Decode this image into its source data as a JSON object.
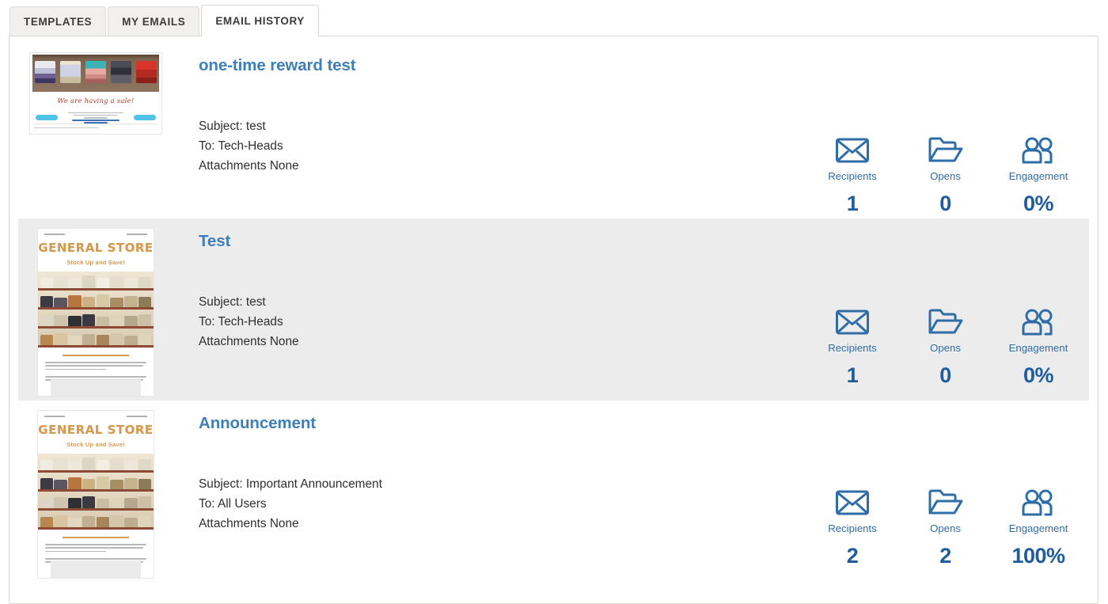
{
  "tabs": [
    {
      "label": "TEMPLATES",
      "active": false
    },
    {
      "label": "MY EMAILS",
      "active": false
    },
    {
      "label": "EMAIL HISTORY",
      "active": true
    }
  ],
  "colors": {
    "link_blue": "#3d7fb8",
    "stat_label_blue": "#2f6da8",
    "stat_value_blue": "#1f5c9e",
    "row_shade": "#ececec",
    "tab_inactive_bg": "#f2f0ee",
    "tab_active_bg": "#ffffff",
    "panel_border": "#d8d5d2"
  },
  "stat_labels": {
    "recipients": "Recipients",
    "opens": "Opens",
    "engagement": "Engagement"
  },
  "icons": {
    "recipients": "envelope-icon",
    "opens": "open-folder-icon",
    "engagement": "two-people-icon"
  },
  "emails": [
    {
      "title": "one-time reward test",
      "subject": "Subject: test",
      "to": "To: Tech-Heads",
      "attachments": "Attachments None",
      "thumbnail_kind": "sale-banner",
      "thumbnail_text": {
        "headline": "We are having a sale!"
      },
      "shaded": false,
      "stats": {
        "recipients": "1",
        "opens": "0",
        "engagement": "0%"
      }
    },
    {
      "title": "Test",
      "subject": "Subject: test",
      "to": "To: Tech-Heads",
      "attachments": "Attachments None",
      "thumbnail_kind": "general-store",
      "thumbnail_text": {
        "headline": "GENERAL STORE",
        "subhead": "Stock Up and Save!"
      },
      "shaded": true,
      "stats": {
        "recipients": "1",
        "opens": "0",
        "engagement": "0%"
      }
    },
    {
      "title": "Announcement",
      "subject": "Subject: Important Announcement",
      "to": "To: All Users",
      "attachments": "Attachments None",
      "thumbnail_kind": "general-store",
      "thumbnail_text": {
        "headline": "GENERAL STORE",
        "subhead": "Stock Up and Save!"
      },
      "shaded": false,
      "stats": {
        "recipients": "2",
        "opens": "2",
        "engagement": "100%"
      }
    }
  ]
}
